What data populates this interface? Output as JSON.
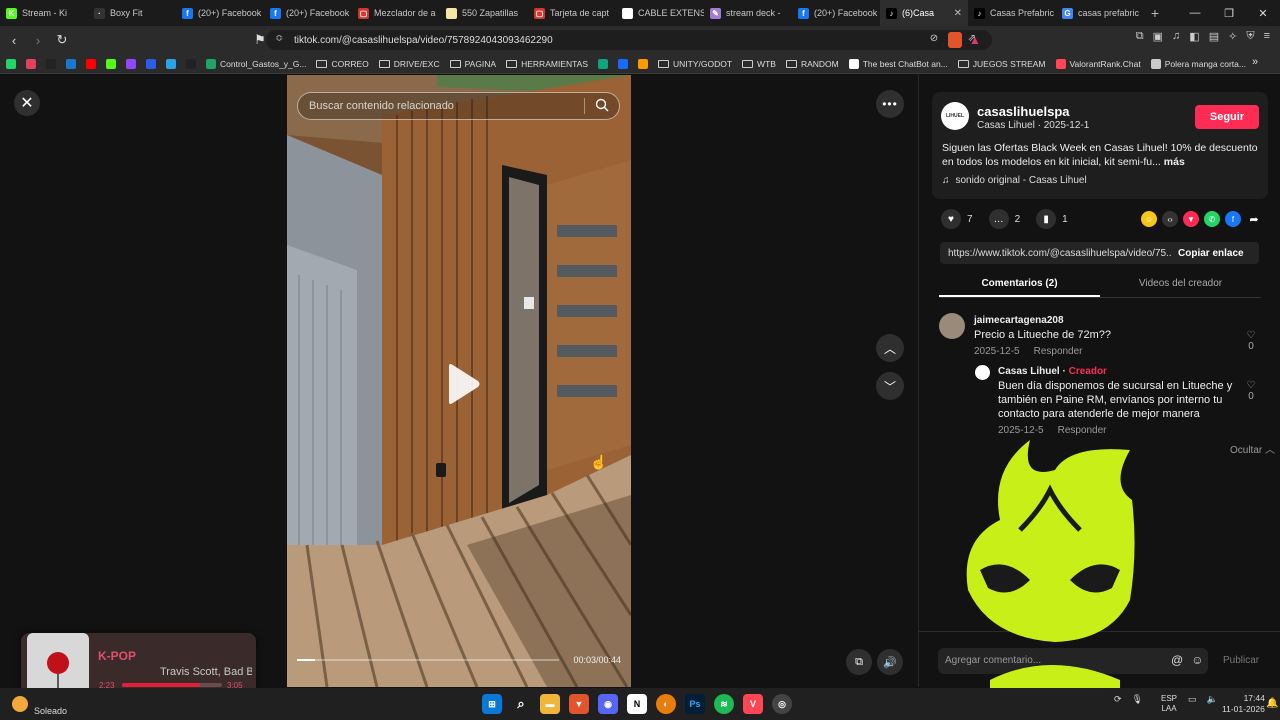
{
  "browser": {
    "tabs": [
      {
        "label": "Stream - Ki",
        "icon": "kick-icon",
        "color": "#53fc18",
        "glyph": "K"
      },
      {
        "label": "Boxy Fit",
        "icon": "boxy-icon",
        "color": "#333333",
        "glyph": "·"
      },
      {
        "label": "(20+) Facebook",
        "icon": "facebook-icon",
        "color": "#1877f2",
        "glyph": "f"
      },
      {
        "label": "(20+) Facebook",
        "icon": "facebook-icon",
        "color": "#1877f2",
        "glyph": "f"
      },
      {
        "label": "Mezclador de a",
        "icon": "mixer-icon",
        "color": "#d9342b",
        "glyph": "▢"
      },
      {
        "label": "550 Zapatillas",
        "icon": "doc-icon",
        "color": "#f7e7a6",
        "glyph": ""
      },
      {
        "label": "Tarjeta de capt",
        "icon": "card-icon",
        "color": "#d9342b",
        "glyph": "▢"
      },
      {
        "label": "CABLE EXTENS",
        "icon": "cable-icon",
        "color": "#ffffff",
        "glyph": "▭"
      },
      {
        "label": "stream deck -",
        "icon": "deck-icon",
        "color": "#a67bd8",
        "glyph": "✎"
      },
      {
        "label": "(20+) Facebook",
        "icon": "facebook-icon",
        "color": "#1877f2",
        "glyph": "f"
      },
      {
        "label": "(6)Casa",
        "icon": "tiktok-icon",
        "color": "#000000",
        "glyph": "♪",
        "active": true
      },
      {
        "label": "Casas Prefabric",
        "icon": "tiktok-icon",
        "color": "#000000",
        "glyph": "♪"
      },
      {
        "label": "casas prefabric",
        "icon": "google-icon",
        "color": "#4285f4",
        "glyph": "G"
      }
    ],
    "url": "tiktok.com/@casaslihuelspa/video/7578924043093462290",
    "bookmarks": [
      {
        "label": "",
        "color": "#25d366"
      },
      {
        "label": "",
        "color": "#e4405f"
      },
      {
        "label": "",
        "color": "#222222"
      },
      {
        "label": "",
        "color": "#1976d2"
      },
      {
        "label": "",
        "color": "#ff0000"
      },
      {
        "label": "",
        "color": "#53fc18"
      },
      {
        "label": "",
        "color": "#9146ff"
      },
      {
        "label": "",
        "color": "#2a5ee8"
      },
      {
        "label": "",
        "color": "#2aa3e8"
      },
      {
        "label": "",
        "color": "#222222"
      },
      {
        "label": "Control_Gastos_y_G...",
        "color": "#1fa463"
      },
      {
        "label": "CORREO",
        "folder": true
      },
      {
        "label": "DRIVE/EXC",
        "folder": true
      },
      {
        "label": "PAGINA",
        "folder": true
      },
      {
        "label": "HERRAMIENTAS",
        "folder": true
      },
      {
        "label": "",
        "color": "#10a37f"
      },
      {
        "label": "",
        "color": "#1769ff"
      },
      {
        "label": "",
        "color": "#ff9900"
      },
      {
        "label": "UNITY/GODOT",
        "folder": true
      },
      {
        "label": "WTB",
        "folder": true
      },
      {
        "label": "RANDOM",
        "folder": true
      },
      {
        "label": "The best ChatBot an...",
        "color": "#ffffff"
      },
      {
        "label": "JUEGOS STREAM",
        "folder": true
      },
      {
        "label": "ValorantRank.Chat",
        "color": "#ff4655"
      },
      {
        "label": "Polera manga corta...",
        "color": "#cccccc"
      }
    ]
  },
  "video": {
    "search_placeholder": "Buscar contenido relacionado",
    "time": "00:03/00:44",
    "progress": 0.07
  },
  "post": {
    "username": "casaslihuelspa",
    "sub": "Casas Lihuel · 2025-12-1",
    "follow_label": "Seguir",
    "description": "Siguen las Ofertas Black Week en Casas Lihuel! 10% de descuento en todos los modelos en kit inicial, kit semi-fu...",
    "more_label": "más",
    "sound": "sonido original - Casas Lihuel",
    "likes": "7",
    "comments": "2",
    "saves": "1",
    "link": "https://www.tiktok.com/@casaslihuelspa/video/75...",
    "copy_label": "Copiar enlace",
    "tab_comments": "Comentarios (2)",
    "tab_videos": "Videos del creador"
  },
  "comments": [
    {
      "user": "jaimecartagena208",
      "text": "Precio a Litueche de 72m??",
      "date": "2025-12-5",
      "reply_label": "Responder",
      "likes": "0"
    },
    {
      "user": "Casas Lihuel",
      "creator_label": "Creador",
      "text": "Buen día disponemos de sucursal en Litueche y también en Paine RM, envíanos por interno tu contacto para atenderle de mejor manera",
      "date": "2025-12-5",
      "reply_label": "Responder",
      "likes": "0"
    }
  ],
  "hide_label": "Ocultar",
  "comment_box": {
    "placeholder": "Agregar comentario...",
    "publish_label": "Publicar"
  },
  "music": {
    "title": "K-POP",
    "artist": "Travis Scott, Bad Bunny",
    "elapsed": "2:23",
    "total": "3:05",
    "progress": 0.78
  },
  "taskbar": {
    "weather": "Soleado",
    "lang1": "ESP",
    "lang2": "LAA",
    "time": "17:44",
    "date": "11-01-2026"
  }
}
